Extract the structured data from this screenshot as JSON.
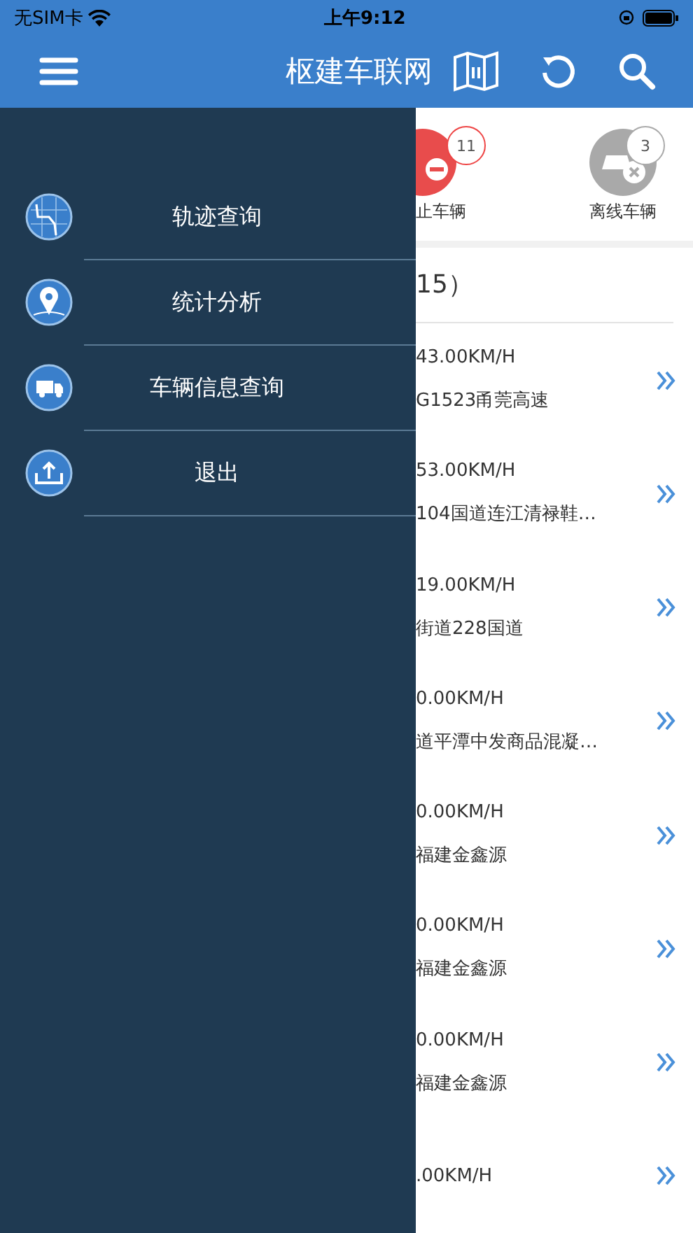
{
  "status_bar": {
    "carrier": "无SIM卡",
    "time": "上午9:12"
  },
  "nav": {
    "title": "枢建车联网"
  },
  "drawer": {
    "items": [
      {
        "kind": "track",
        "label": "轨迹查询"
      },
      {
        "kind": "pin",
        "label": "统计分析"
      },
      {
        "kind": "truck",
        "label": "车辆信息查询"
      },
      {
        "kind": "exit",
        "label": "退出"
      }
    ]
  },
  "stats": [
    {
      "kind": "stopped",
      "label": "止车辆",
      "count": "11"
    },
    {
      "kind": "offline",
      "label": "离线车辆",
      "count": "3"
    }
  ],
  "list": {
    "header": "15）",
    "rows": [
      {
        "speed": "43.00KM/H",
        "address": "G1523甬莞高速"
      },
      {
        "speed": "53.00KM/H",
        "address": "104国道连江清禄鞋…"
      },
      {
        "speed": "19.00KM/H",
        "address": "街道228国道"
      },
      {
        "speed": "0.00KM/H",
        "address": "道平潭中发商品混凝…"
      },
      {
        "speed": "0.00KM/H",
        "address": "福建金鑫源"
      },
      {
        "speed": "0.00KM/H",
        "address": "福建金鑫源"
      },
      {
        "speed": "0.00KM/H",
        "address": "福建金鑫源"
      },
      {
        "speed": ".00KM/H"
      }
    ]
  }
}
